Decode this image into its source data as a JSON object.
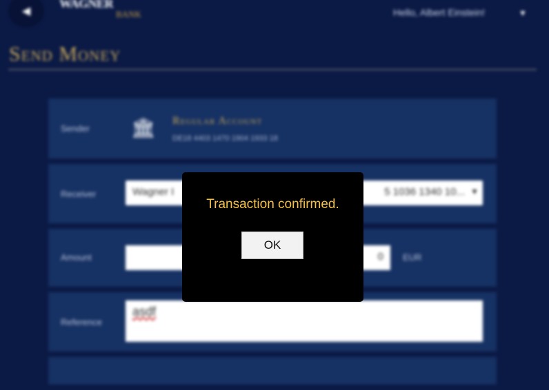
{
  "header": {
    "back_icon": "arrow-left-icon",
    "logo_top": "WAGNER",
    "logo_bottom": "BANK",
    "greeting": "Hello, Albert Einstein!",
    "menu_icon": "caret-down-icon"
  },
  "page_title": "Send Money",
  "form": {
    "sender": {
      "label": "Sender",
      "icon": "bank-icon",
      "account_name": "Regular Account",
      "account_number": "DE18 4403 1470 1904 1933 18"
    },
    "receiver": {
      "label": "Receiver",
      "selected_name": "Wagner I",
      "selected_iban": "5 1036 1340 10..."
    },
    "amount": {
      "label": "Amount",
      "value": "0",
      "currency": "EUR"
    },
    "reference": {
      "label": "Reference",
      "value": "asdf"
    }
  },
  "modal": {
    "message": "Transaction confirmed.",
    "ok_label": "OK"
  },
  "colors": {
    "background": "#0b1a45",
    "panel": "#163163",
    "accent_gold": "#c9a85a",
    "modal_text": "#f5c04a"
  }
}
